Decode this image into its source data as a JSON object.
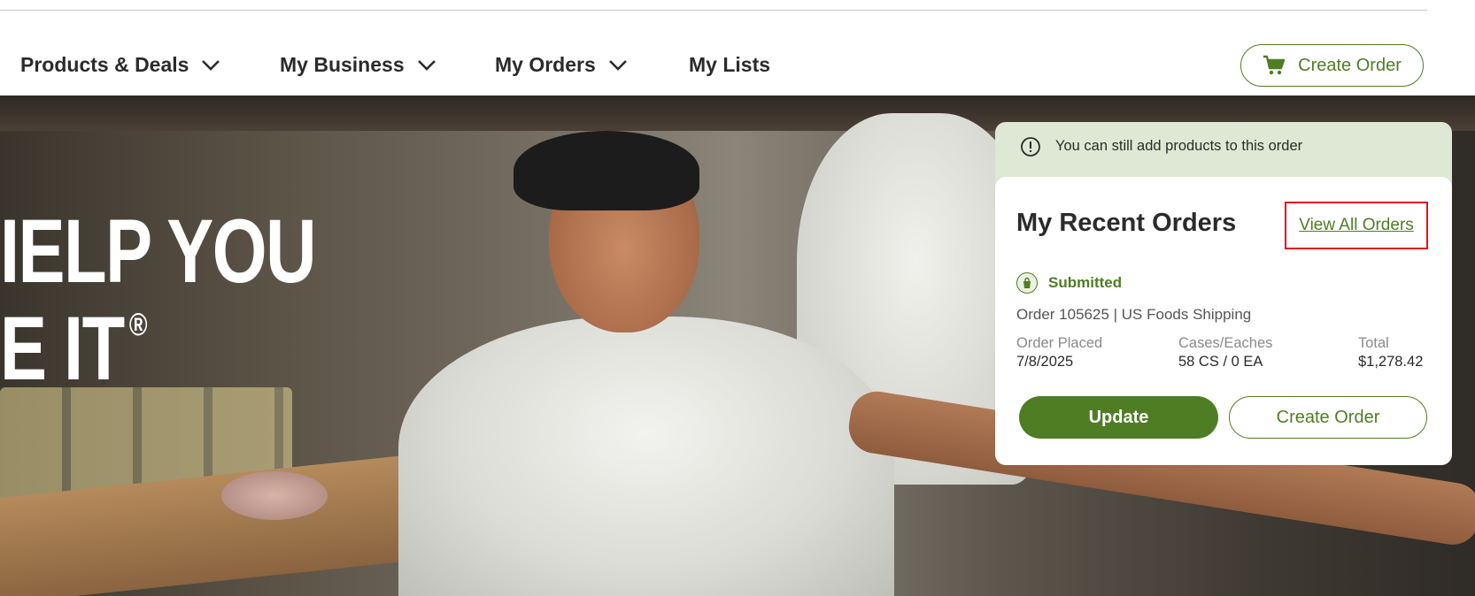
{
  "nav": {
    "items": [
      {
        "label": "Products & Deals",
        "has_dropdown": true
      },
      {
        "label": "My Business",
        "has_dropdown": true
      },
      {
        "label": "My Orders",
        "has_dropdown": true
      },
      {
        "label": "My Lists",
        "has_dropdown": false
      }
    ],
    "cta_label": "Create Order",
    "cta_icon": "cart-icon"
  },
  "hero": {
    "line1": "IELP YOU",
    "line2": "E IT",
    "reg_mark": "®"
  },
  "alert": {
    "icon": "info-icon",
    "text": "You can still add products to this order"
  },
  "recent_orders": {
    "title": "My Recent Orders",
    "view_all_label": "View All Orders",
    "status": "Submitted",
    "status_icon": "shopping-bag-icon",
    "order_line": "Order 105625  | US Foods Shipping",
    "placed_label": "Order Placed",
    "placed_value": "7/8/2025",
    "cases_label": "Cases/Eaches",
    "cases_value": "58 CS / 0 EA",
    "total_label": "Total",
    "total_value": "$1,278.42",
    "update_label": "Update",
    "create_label": "Create Order"
  },
  "colors": {
    "brand_green": "#4f7d24",
    "alert_bg": "#dfe8d4",
    "highlight_red": "#e1141b"
  }
}
